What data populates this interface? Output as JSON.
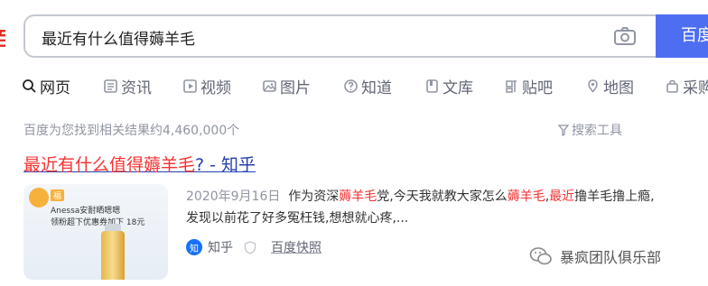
{
  "search": {
    "query": "最近有什么值得薅羊毛",
    "button_label": "百度一下"
  },
  "tabs": [
    {
      "label": "网页",
      "icon": "search-icon",
      "active": true
    },
    {
      "label": "资讯",
      "icon": "news-icon"
    },
    {
      "label": "视频",
      "icon": "video-icon"
    },
    {
      "label": "图片",
      "icon": "image-icon"
    },
    {
      "label": "知道",
      "icon": "question-icon"
    },
    {
      "label": "文库",
      "icon": "document-icon"
    },
    {
      "label": "贴吧",
      "icon": "tieba-icon"
    },
    {
      "label": "地图",
      "icon": "map-pin-icon"
    },
    {
      "label": "采购",
      "icon": "shopping-bag-icon"
    }
  ],
  "result_count": "百度为您找到相关结果约4,460,000个",
  "search_tools": "搜索工具",
  "result": {
    "title_em": "最近有什么值得薅羊毛",
    "title_rest": "? - 知乎",
    "date": "2020年9月16日",
    "abstract_1": "作为资深",
    "abstract_em1": "薅羊毛",
    "abstract_2": "党,今天我就教大家怎么",
    "abstract_em2": "薅羊毛",
    "abstract_3": ",",
    "abstract_em3": "最近",
    "abstract_4": "撸羊毛撸上瘾,发现以前花了好多冤枉钱,想想就心疼,...",
    "source_logo": "知",
    "source_name": "知乎",
    "snapshot": "百度快照",
    "thumb": {
      "tag": "福",
      "line1": "Anessa安耐晒嗯嗯",
      "line2": "领粉超下优惠券加下 18元"
    }
  },
  "watermark": "暴疯团队俱乐部",
  "colors": {
    "accent": "#4e6ef2",
    "link": "#2440b3",
    "highlight": "#f73131",
    "muted": "#9195a3"
  }
}
